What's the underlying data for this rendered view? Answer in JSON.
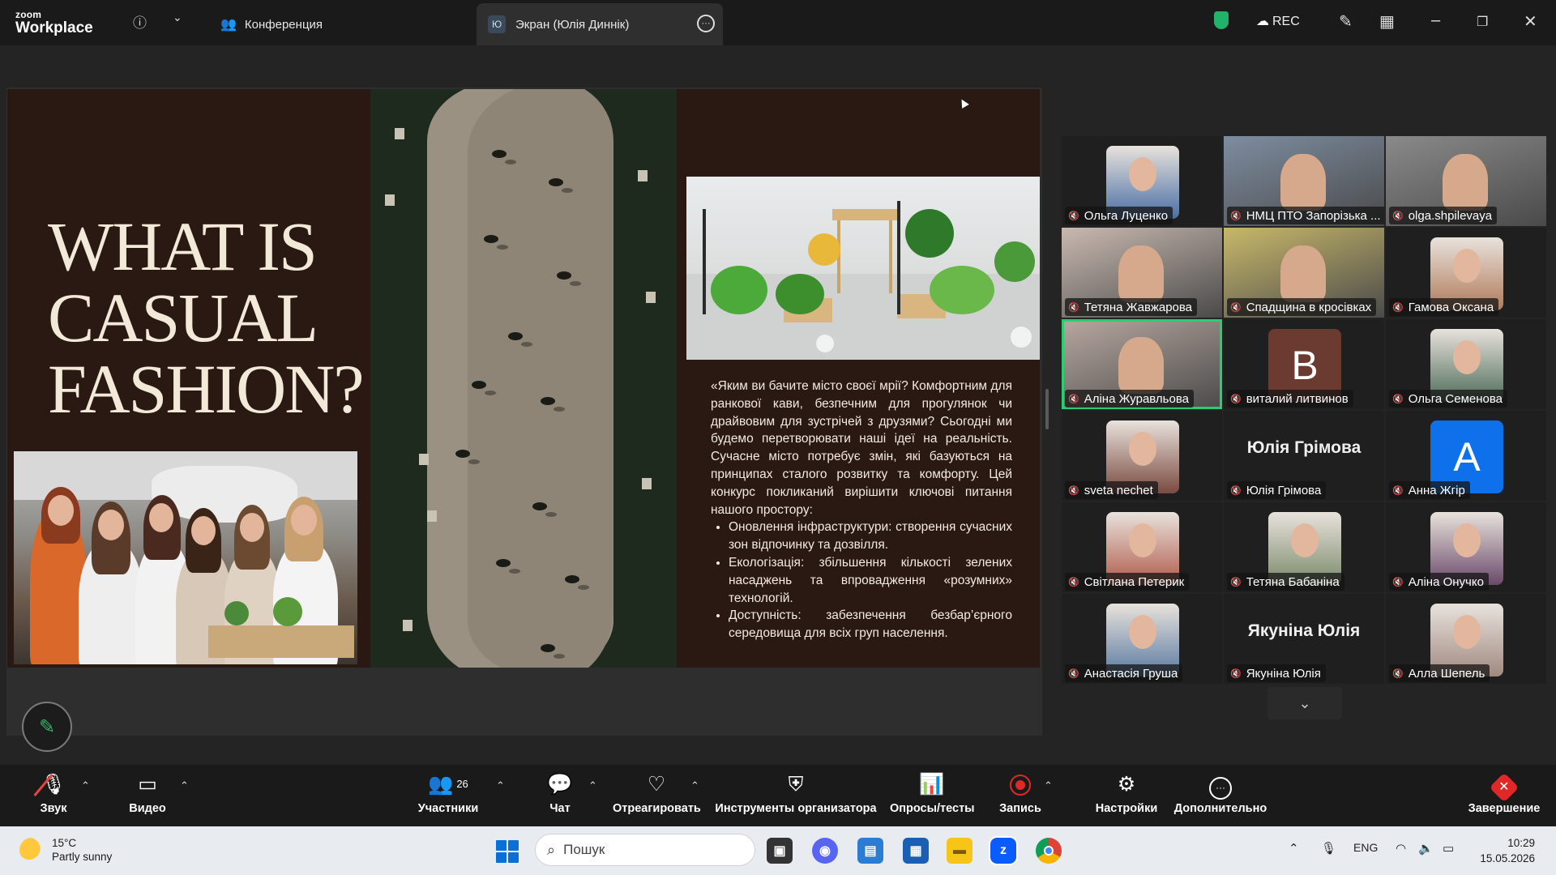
{
  "app": {
    "logo_top": "zoom",
    "logo_bottom": "Workplace"
  },
  "titlebar": {
    "meeting_tab": "Конференция",
    "share_tab": "Экран (Юлія Диннік)",
    "share_avatar": "Ю",
    "rec_label": "REC"
  },
  "slide": {
    "title_lines": [
      "WHAT IS",
      "CASUAL",
      "FASHION?"
    ],
    "paragraph": "«Яким ви бачите місто своєї мрії? Комфортним для ранкової кави, безпечним для прогулянок чи драйвовим для зустрічей з друзями? Сьогодні ми будемо перетворювати наші ідеї на реальність. Сучасне місто потребує змін, які базуються на принципах сталого розвитку та комфорту. Цей конкурс покликаний вирішити ключові питання нашого простору:",
    "bullets": [
      "Оновлення інфраструктури: створення сучасних зон відпочинку та дозвілля.",
      "Екологізація: збільшення кількості зелених насаджень та впровадження «розумних» технологій.",
      "Доступність: забезпечення безбар’єрного середовища для всіх груп населення."
    ]
  },
  "participants": [
    {
      "name": "Ольга Луценко",
      "type": "avatar",
      "color": "#4a6fa5"
    },
    {
      "name": "НМЦ ПТО Запорізька ...",
      "type": "camera",
      "color": "#7d8da0"
    },
    {
      "name": "olga.shpilevaya",
      "type": "camera",
      "color": "#8a8a8a"
    },
    {
      "name": "Тетяна Жавжарова",
      "type": "camera",
      "color": "#c9b9b0"
    },
    {
      "name": "Спадщина в кросівках",
      "type": "camera",
      "color": "#c8b86a"
    },
    {
      "name": "Гамова Оксана",
      "type": "avatar",
      "color": "#b07a5a"
    },
    {
      "name": "Аліна Журавльова",
      "type": "camera",
      "color": "#b8a8a0",
      "speaking": true
    },
    {
      "name": "виталий литвинов",
      "type": "letter",
      "letter": "B",
      "color": "#6b3a30"
    },
    {
      "name": "Ольга Семенова",
      "type": "avatar",
      "color": "#4d6b5a"
    },
    {
      "name": "sveta nechet",
      "type": "avatar",
      "color": "#7a4a40"
    },
    {
      "name": "Юлія Грімова",
      "type": "name",
      "big": "Юлія Грімова"
    },
    {
      "name": "Анна Жгір",
      "type": "letter",
      "letter": "A",
      "color": "#0e71eb"
    },
    {
      "name": "Світлана Петерик",
      "type": "avatar",
      "color": "#b05a4a"
    },
    {
      "name": "Тетяна Бабаніна",
      "type": "avatar",
      "color": "#7a8a6a"
    },
    {
      "name": "Аліна Онучко",
      "type": "avatar",
      "color": "#6a4a6a"
    },
    {
      "name": "Анастасія Груша",
      "type": "avatar",
      "color": "#5a7aa0"
    },
    {
      "name": "Якуніна Юлія",
      "type": "name",
      "big": "Якуніна Юлія"
    },
    {
      "name": "Алла Шепель",
      "type": "avatar",
      "color": "#a08a80"
    }
  ],
  "toolbar": {
    "audio": "Звук",
    "video": "Видео",
    "participants": "Участники",
    "participants_count": "26",
    "chat": "Чат",
    "react": "Отреагировать",
    "host_tools": "Инструменты организатора",
    "polls": "Опросы/тесты",
    "record": "Запись",
    "settings": "Настройки",
    "more": "Дополнительно",
    "end": "Завершение"
  },
  "taskbar": {
    "temp": "15°C",
    "weather": "Partly sunny",
    "search_placeholder": "Пошук",
    "lang": "ENG",
    "time": "10:29",
    "date": "15.05.2026"
  },
  "colors": {
    "accent_green": "#2ecc71",
    "mute_red": "#e24545",
    "end_red": "#e02828",
    "zoom_blue": "#0b5cff"
  }
}
